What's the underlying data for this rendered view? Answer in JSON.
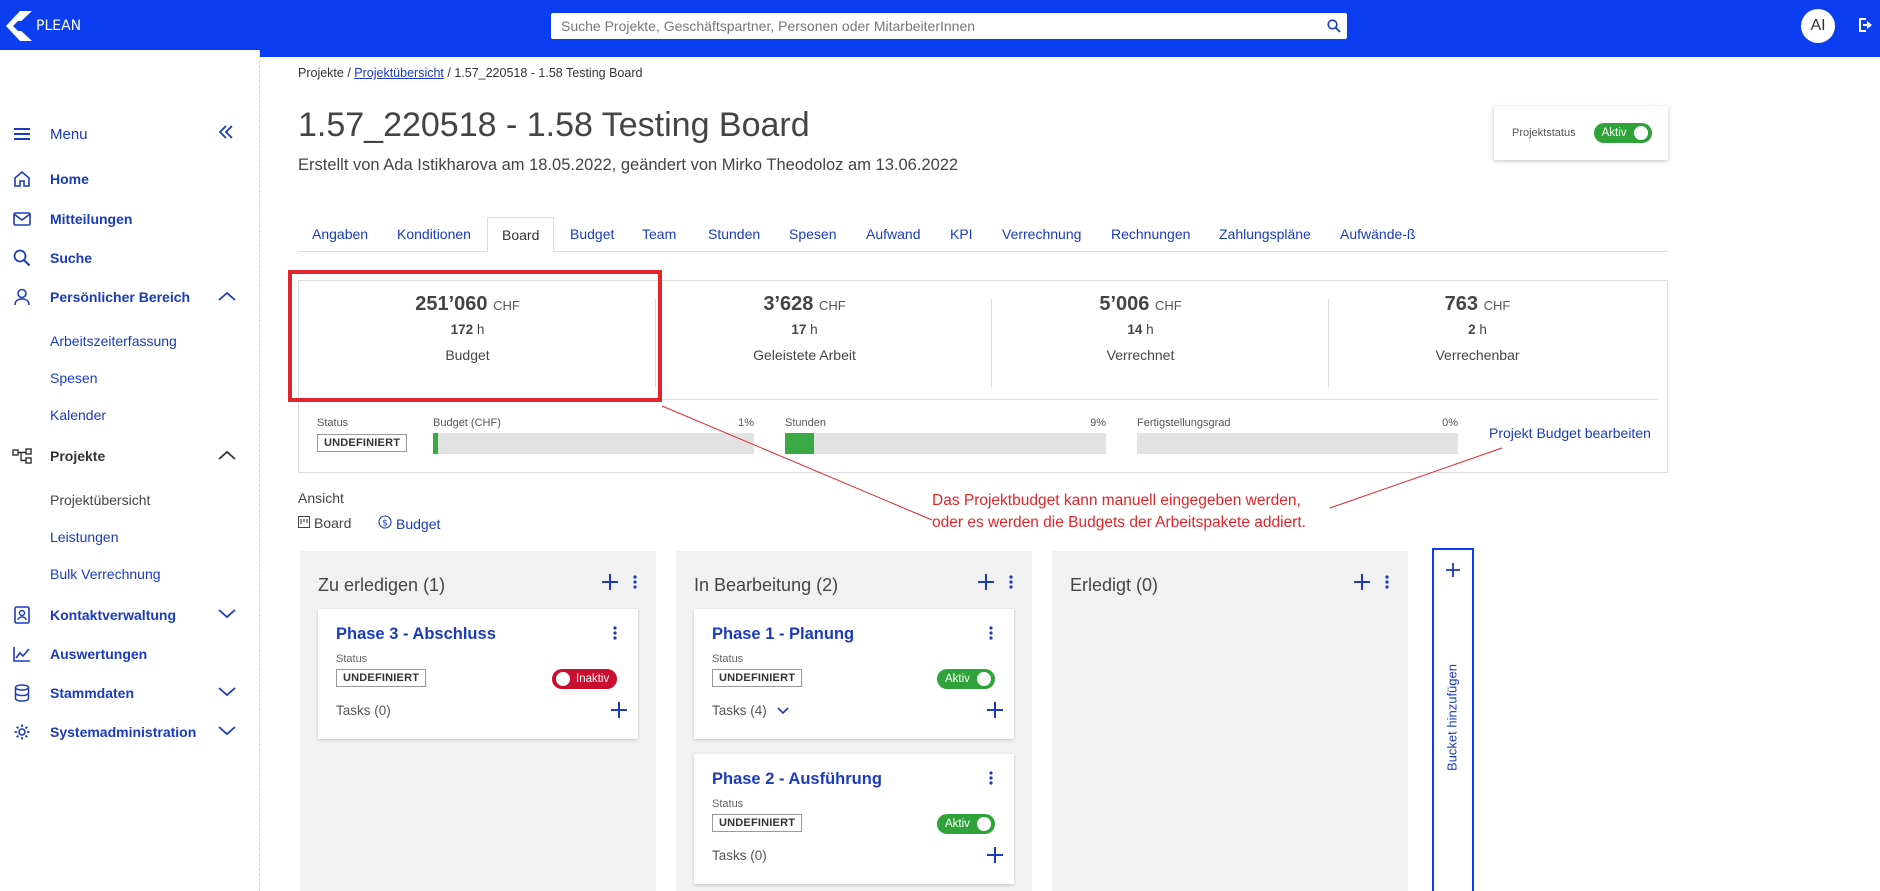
{
  "header": {
    "logo_text": "PLEAN",
    "search_placeholder": "Suche Projekte, Geschäftspartner, Personen oder MitarbeiterInnen",
    "avatar_initials": "AI",
    "brand_color": "#0a3ef0"
  },
  "sidebar": {
    "menu_label": "Menu",
    "items": {
      "home": "Home",
      "mitteilungen": "Mitteilungen",
      "suche": "Suche",
      "persoenlich": "Persönlicher Bereich",
      "arbeitszeit": "Arbeitszeiterfassung",
      "spesen": "Spesen",
      "kalender": "Kalender",
      "projekte": "Projekte",
      "projektuebersicht": "Projektübersicht",
      "leistungen": "Leistungen",
      "bulk": "Bulk Verrechnung",
      "kontakt": "Kontaktverwaltung",
      "auswertungen": "Auswertungen",
      "stammdaten": "Stammdaten",
      "systemadmin": "Systemadministration"
    }
  },
  "breadcrumb": {
    "root": "Projekte",
    "sep1": " / ",
    "parent": "Projektübersicht",
    "sep2": " / ",
    "current": "1.57_220518 - 1.58 Testing Board"
  },
  "page": {
    "title": "1.57_220518 - 1.58 Testing Board",
    "subtitle": "Erstellt von Ada Istikharova am 18.05.2022, geändert von Mirko Theodoloz am 13.06.2022",
    "status_label": "Projektstatus",
    "status_value": "Aktiv"
  },
  "tabs": [
    "Angaben",
    "Konditionen",
    "Board",
    "Budget",
    "Team",
    "Stunden",
    "Spesen",
    "Aufwand",
    "KPI",
    "Verrechnung",
    "Rechnungen",
    "Zahlungspläne",
    "Aufwände-ß"
  ],
  "summary": {
    "kpis": [
      {
        "amount": "251’060",
        "unit": "CHF",
        "hours": "172",
        "hours_unit": "h",
        "caption": "Budget"
      },
      {
        "amount": "3’628",
        "unit": "CHF",
        "hours": "17",
        "hours_unit": "h",
        "caption": "Geleistete Arbeit"
      },
      {
        "amount": "5’006",
        "unit": "CHF",
        "hours": "14",
        "hours_unit": "h",
        "caption": "Verrechnet"
      },
      {
        "amount": "763",
        "unit": "CHF",
        "hours": "2",
        "hours_unit": "h",
        "caption": "Verrechenbar"
      }
    ],
    "status_label": "Status",
    "status_badge": "UNDEFINIERT",
    "bars": [
      {
        "label": "Budget (CHF)",
        "pct_text": "1%",
        "fraction": 0.01
      },
      {
        "label": "Stunden",
        "pct_text": "9%",
        "fraction": 0.09
      },
      {
        "label": "Fertigstellungsgrad",
        "pct_text": "0%",
        "fraction": 0.0
      }
    ],
    "edit_link": "Projekt Budget bearbeiten"
  },
  "view": {
    "label": "Ansicht",
    "board": "Board",
    "budget": "Budget"
  },
  "annotation": {
    "line1": "Das Projektbudget kann manuell eingegeben werden,",
    "line2": "oder es werden die Budgets der Arbeitspakete addiert.",
    "color": "#e1252b"
  },
  "board": {
    "columns": [
      {
        "title": "Zu erledigen (1)"
      },
      {
        "title": "In Bearbeitung (2)"
      },
      {
        "title": "Erledigt (0)"
      }
    ],
    "cards": [
      {
        "title": "Phase 3 - Abschluss",
        "status_label": "Status",
        "status": "UNDEFINIERT",
        "toggle": "Inaktiv",
        "tasks": "Tasks (0)"
      },
      {
        "title": "Phase 1 - Planung",
        "status_label": "Status",
        "status": "UNDEFINIERT",
        "toggle": "Aktiv",
        "tasks": "Tasks (4)"
      },
      {
        "title": "Phase 2 - Ausführung",
        "status_label": "Status",
        "status": "UNDEFINIERT",
        "toggle": "Aktiv",
        "tasks": "Tasks (0)"
      }
    ],
    "add_bucket": "Bucket hinzufügen"
  }
}
